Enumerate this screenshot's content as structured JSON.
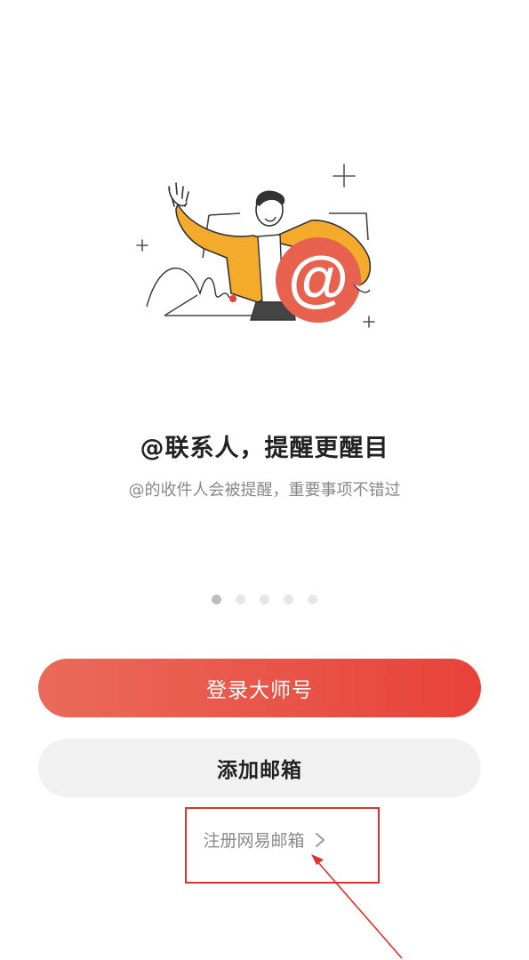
{
  "onboarding": {
    "title": "@联系人，提醒更醒目",
    "subtitle": "@的收件人会被提醒，重要事项不错过",
    "pages": 5,
    "active_page": 1,
    "illustration_icon": "person-waving-with-at-sign"
  },
  "actions": {
    "login_label": "登录大师号",
    "add_mailbox_label": "添加邮箱",
    "register_label": "注册网易邮箱"
  },
  "colors": {
    "primary_start": "#ea6a5a",
    "primary_end": "#e8423a",
    "accent_orange": "#f4ab2c",
    "highlight_red": "#e0302c"
  }
}
